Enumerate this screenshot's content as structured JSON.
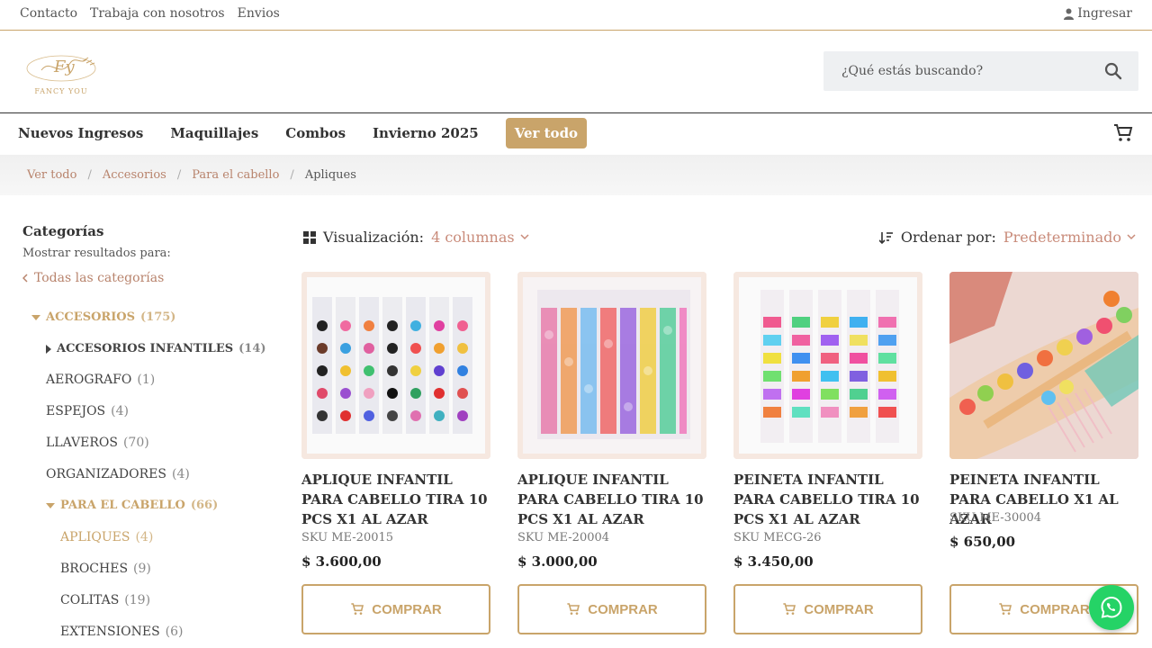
{
  "topbar": {
    "links": [
      "Contacto",
      "Trabaja con nosotros",
      "Envios"
    ],
    "login": "Ingresar"
  },
  "logo": {
    "text": "FANCY YOU",
    "monogram": "Fy"
  },
  "search": {
    "placeholder": "¿Qué estás buscando?"
  },
  "nav": {
    "items": [
      "Nuevos Ingresos",
      "Maquillajes",
      "Combos",
      "Invierno 2025"
    ],
    "active": "Ver todo"
  },
  "breadcrumb": [
    "Ver todo",
    "Accesorios",
    "Para el cabello",
    "Apliques"
  ],
  "sidebar": {
    "title": "Categorías",
    "subtitle": "Mostrar resultados para:",
    "all_label": "Todas las categorías",
    "categories": [
      {
        "label": "ACCESORIOS",
        "count": "(175)"
      },
      {
        "label": "ACCESORIOS INFANTILES",
        "count": "(14)"
      },
      {
        "label": "AEROGRAFO",
        "count": "(1)"
      },
      {
        "label": "ESPEJOS",
        "count": "(4)"
      },
      {
        "label": "LLAVEROS",
        "count": "(70)"
      },
      {
        "label": "ORGANIZADORES",
        "count": "(4)"
      },
      {
        "label": "PARA EL CABELLO",
        "count": "(66)"
      },
      {
        "label": "APLIQUES",
        "count": "(4)"
      },
      {
        "label": "BROCHES",
        "count": "(9)"
      },
      {
        "label": "COLITAS",
        "count": "(19)"
      },
      {
        "label": "EXTENSIONES",
        "count": "(6)"
      }
    ]
  },
  "toolbar": {
    "view_label": "Visualización:",
    "view_value": "4 columnas",
    "sort_label": "Ordenar por:",
    "sort_value": "Predeterminado"
  },
  "products": [
    {
      "name": "APLIQUE INFANTIL PARA CABELLO TIRA 10 PCS X1 AL AZAR",
      "sku": "SKU ME-20015",
      "price": "$  3.600,00",
      "button": "COMPRAR"
    },
    {
      "name": "APLIQUE INFANTIL PARA CABELLO TIRA 10 PCS X1 AL AZAR",
      "sku": "SKU ME-20004",
      "price": "$  3.000,00",
      "button": "COMPRAR"
    },
    {
      "name": "PEINETA INFANTIL PARA CABELLO TIRA 10 PCS X1 AL AZAR",
      "sku": "SKU MECG-26",
      "price": "$  3.450,00",
      "button": "COMPRAR"
    },
    {
      "name": "PEINETA INFANTIL PARA CABELLO X1 AL AZAR",
      "sku": "SKU ME-30004",
      "price": "$  650,00",
      "button": "COMPRAR"
    }
  ],
  "colors": {
    "gold": "#c9a46a",
    "rose": "#c98b7a",
    "whatsapp": "#25d366"
  }
}
